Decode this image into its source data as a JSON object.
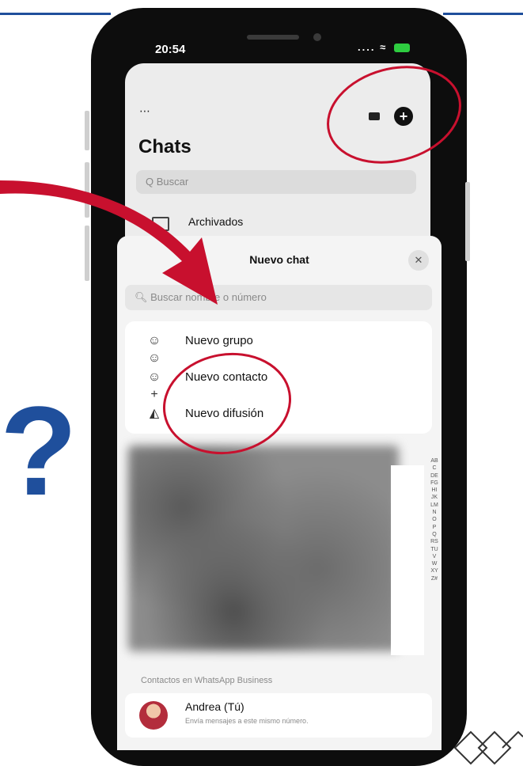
{
  "status_bar": {
    "time": "20:54",
    "signal": "....",
    "wifi": "wifi-icon",
    "battery": "battery-icon"
  },
  "chats_screen": {
    "more_icon": "⋯",
    "title": "Chats",
    "search_placeholder": "Q Buscar",
    "archived_label": "Archivados",
    "camera_icon": "camera-icon",
    "new_chat_icon": "+"
  },
  "new_chat_sheet": {
    "title": "Nuevo chat",
    "close": "✕",
    "search_placeholder": "Buscar nombre o número",
    "options": [
      {
        "label": "Nuevo grupo",
        "icon": "group-icon"
      },
      {
        "label": "Nuevo contacto",
        "icon": "add-contact-icon"
      },
      {
        "label": "Nuevo difusión",
        "icon": "broadcast-icon"
      }
    ],
    "index_letters": "ABCDEFGHIJKLMNOPQRSTUVWXYZ#",
    "section_label": "Contactos en WhatsApp Business",
    "contact": {
      "name": "Andrea (Tú)",
      "subtitle": "Envía mensajes a este mismo número."
    }
  },
  "decor": {
    "question_mark": "?",
    "accent_color": "#c8102e",
    "brand_color": "#1f4f9c"
  }
}
